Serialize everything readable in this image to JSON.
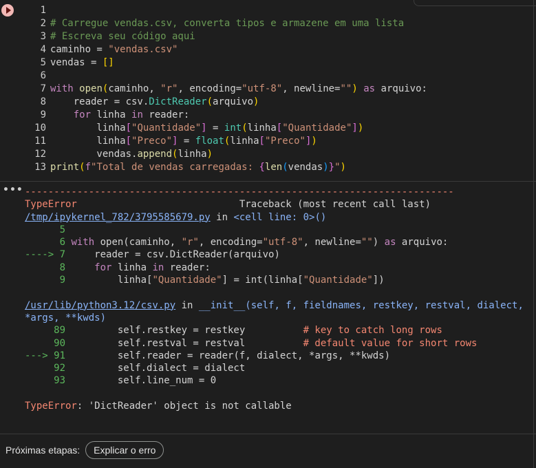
{
  "code": {
    "line_numbers": [
      "1",
      "2",
      "3",
      "4",
      "5",
      "6",
      "7",
      "8",
      "9",
      "10",
      "11",
      "12",
      "13"
    ],
    "l2": "# Carregue vendas.csv, converta tipos e armazene em uma lista",
    "l3": "# Escreva seu código aqui",
    "l4": {
      "a": "caminho = ",
      "b": "\"vendas.csv\""
    },
    "l5": {
      "a": "vendas = ",
      "b": "[]"
    },
    "l7": {
      "kw": "with",
      "fn": "open",
      "arg": "caminho, ",
      "s1": "\"r\"",
      "c1": ", encoding=",
      "s2": "\"utf-8\"",
      "c2": ", newline=",
      "s3": "\"\"",
      "as": "as",
      "var": "arquivo:"
    },
    "l8": {
      "a": "    reader = csv.",
      "fn": "DictReader",
      "b": "arquivo"
    },
    "l9": {
      "kw": "for",
      "a": " linha ",
      "in": "in",
      "b": " reader:"
    },
    "l10": {
      "a": "        linha",
      "s1": "\"Quantidade\"",
      "b": " = ",
      "fn": "int",
      "c": "linha",
      "s2": "\"Quantidade\""
    },
    "l11": {
      "a": "        linha",
      "s1": "\"Preco\"",
      "b": " = ",
      "fn": "float",
      "c": "linha",
      "s2": "\"Preco\""
    },
    "l12": {
      "a": "        vendas.",
      "fn": "append",
      "b": "linha"
    },
    "l13": {
      "fn": "print",
      "f": "f",
      "s1": "\"Total de vendas carregadas: ",
      "len": "len",
      "v": "vendas",
      "s2": "\""
    }
  },
  "output": {
    "dashes": "--------------------------------------------------------------------------",
    "err_name": "TypeError",
    "traceback_label": "Traceback (most recent call last)",
    "frame1_file": "/tmp/ipykernel_782/3795585679.py",
    "frame1_in": " in ",
    "frame1_loc": "<cell line: 0>()",
    "f1_l5": "      5",
    "f1_l6_num": "      6 ",
    "f1_l6": {
      "kw": "with",
      "a": " open(caminho, ",
      "s1": "\"r\"",
      "b": ", encoding=",
      "s2": "\"utf-8\"",
      "c": ", newline=",
      "s3": "\"\"",
      "d": ") ",
      "as": "as",
      "e": " arquivo:"
    },
    "f1_l7_arrow": "----> 7",
    "f1_l7": "     reader = csv.DictReader(arquivo)",
    "f1_l8_num": "      8     ",
    "f1_l8": {
      "kw": "for",
      "a": " linha ",
      "in": "in",
      "b": " reader:"
    },
    "f1_l9_num": "      9         ",
    "f1_l9": {
      "a": "linha[",
      "s1": "\"Quantidade\"",
      "b": "] = int(linha[",
      "s2": "\"Quantidade\"",
      "c": "])"
    },
    "frame2_file": "/usr/lib/python3.12/csv.py",
    "frame2_in": " in ",
    "frame2_loc": "__init__(self, f, fieldnames, restkey, restval, dialect,",
    "frame2_loc2": "*args, **kwds)",
    "f2_l89_num": "     89         ",
    "f2_l89": "self.restkey = restkey          ",
    "f2_l89_cm": "# key to catch long rows",
    "f2_l90_num": "     90         ",
    "f2_l90": "self.restval = restval          ",
    "f2_l90_cm": "# default value for short rows",
    "f2_l91_arrow": "---> 91",
    "f2_l91": "         self.reader = reader(f, dialect, *args, **kwds)",
    "f2_l92_num": "     92         ",
    "f2_l92": "self.dialect = dialect",
    "f2_l93_num": "     93         ",
    "f2_l93": "self.line_num = 0",
    "final_name": "TypeError",
    "final_msg": ": 'DictReader' object is not callable"
  },
  "next_steps": {
    "label": "Próximas etapas:",
    "button": "Explicar o erro"
  },
  "colors": {
    "error": "#f48771",
    "link": "#8ab4f8",
    "green": "#5cb85c",
    "accent": "#f2b8b5"
  }
}
